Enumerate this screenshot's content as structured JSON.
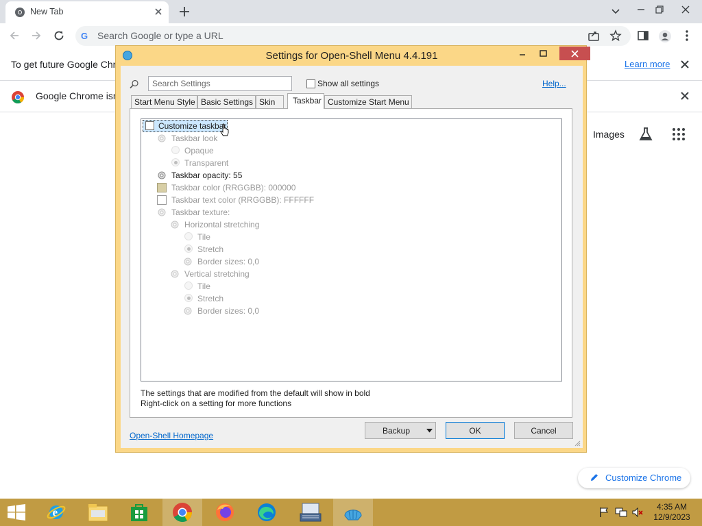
{
  "browser": {
    "tab_title": "New Tab",
    "omnibox_placeholder": "Search Google or type a URL",
    "infobar_updates_text": "To get future Google Chrome updates, you'll need Windows 10 or later",
    "infobar_updates_link": "Learn more",
    "infobar_default_text": "Google Chrome isn't your default browser",
    "ntp_images": "Images",
    "customize_label": "Customize Chrome"
  },
  "dialog": {
    "title": "Settings for Open-Shell Menu 4.4.191",
    "search_placeholder": "Search Settings",
    "show_all_label": "Show all settings",
    "help_label": "Help...",
    "tabs": [
      "Start Menu Style",
      "Basic Settings",
      "Skin",
      "Taskbar",
      "Customize Start Menu"
    ],
    "active_tab": "Taskbar",
    "tree": [
      "Customize taskbar",
      "Taskbar look",
      "Opaque",
      "Transparent",
      "Taskbar opacity: 55",
      "Taskbar color (RRGGBB): 000000",
      "Taskbar text color (RRGGBB): FFFFFF",
      "Taskbar texture:",
      "Horizontal stretching",
      "Tile",
      "Stretch",
      "Border sizes: 0,0",
      "Vertical stretching",
      "Tile",
      "Stretch",
      "Border sizes: 0,0"
    ],
    "note_bold": "The settings that are modified from the default will show in bold",
    "note_rightclick": "Right-click on a setting for more functions",
    "homepage_link": "Open-Shell Homepage",
    "btn_backup": "Backup",
    "btn_ok": "OK",
    "btn_cancel": "Cancel"
  },
  "taskbar": {
    "time": "4:35 AM",
    "date": "12/9/2023"
  },
  "colors": {
    "dialog_frame": "#fbd787",
    "taskbar": "#c19b43",
    "chrome_link": "#1a73e8",
    "dialog_close": "#c74f50"
  }
}
